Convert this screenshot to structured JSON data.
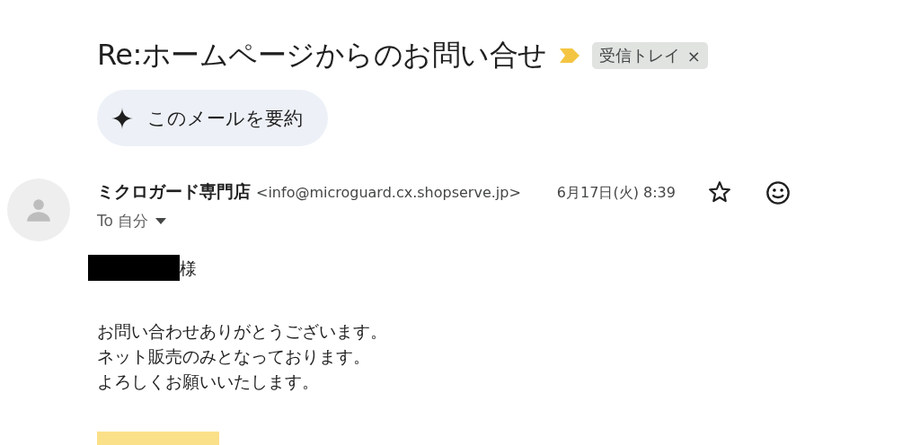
{
  "subject": "Re:ホームページからのお問い合せ",
  "important": true,
  "label": {
    "text": "受信トレイ",
    "remove": "×"
  },
  "summarize_button": "このメールを要約",
  "sender": {
    "name": "ミクロガード専門店",
    "email": "<info@microguard.cx.shopserve.jp>",
    "date": "6月17日(火) 8:39",
    "starred": false,
    "recipient": "To 自分"
  },
  "body": {
    "salutation": "様",
    "paragraphs": [
      [
        "お問い合わせありがとうございます。",
        "ネット販売のみとなっております。",
        "よろしくお願いいたします。"
      ]
    ]
  }
}
